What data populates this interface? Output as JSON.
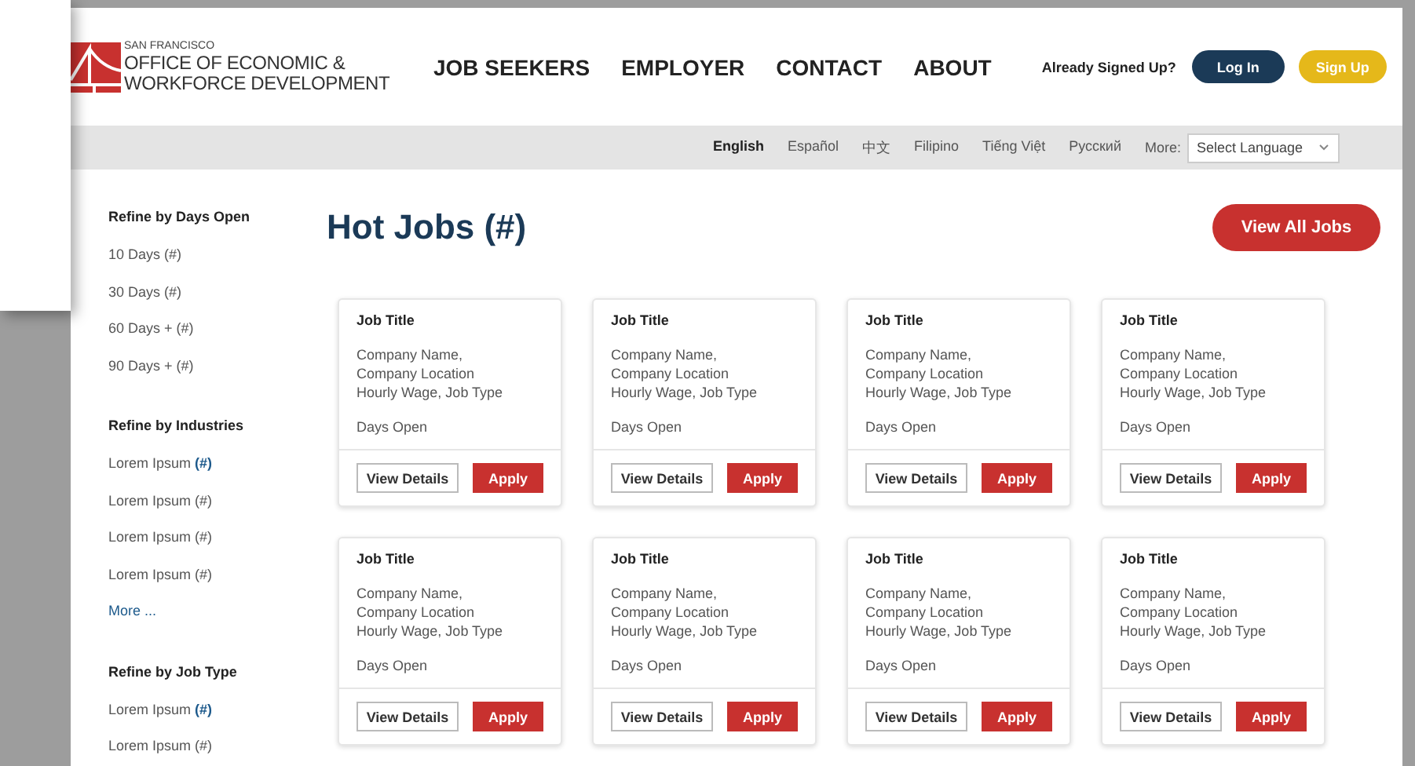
{
  "logo": {
    "city": "SAN FRANCISCO",
    "line_1": "OFFICE OF ECONOMIC &",
    "line_2": "WORKFORCE DEVELOPMENT"
  },
  "nav": [
    {
      "label": "JOB SEEKERS"
    },
    {
      "label": "EMPLOYER"
    },
    {
      "label": "CONTACT"
    },
    {
      "label": "ABOUT"
    }
  ],
  "account": {
    "prompt": "Already Signed Up?",
    "login": "Log In",
    "signup": "Sign Up"
  },
  "languages": [
    {
      "label": "English",
      "selected": true
    },
    {
      "label": "Español",
      "selected": false
    },
    {
      "label": "中文",
      "selected": false
    },
    {
      "label": "Filipino",
      "selected": false
    },
    {
      "label": "Tiếng Việt",
      "selected": false
    },
    {
      "label": "Русский",
      "selected": false
    }
  ],
  "language_more": {
    "label": "More:",
    "select": "Select Language"
  },
  "sidebar": [
    {
      "heading": "Refine by Days Open",
      "items": [
        "10 Days (#)",
        "30 Days (#)",
        "60 Days + (#)",
        "90 Days + (#)"
      ]
    },
    {
      "heading": "Refine by Industries",
      "items": [
        "Lorem Ipsum **(#)**",
        "Lorem Ipsum (#)",
        "Lorem Ipsum (#)",
        "Lorem Ipsum (#)"
      ],
      "more": "More ..."
    },
    {
      "heading": "Refine by Job Type",
      "items": [
        "Lorem Ipsum **(#)**",
        "Lorem Ipsum (#)"
      ]
    }
  ],
  "main": {
    "title": "Hot Jobs (#)",
    "view_all": "View All Jobs"
  },
  "jobs": [
    {
      "title": "Job Title",
      "company": "Company Name,",
      "location": "Company Location",
      "wage_type": "Hourly Wage, Job Type",
      "days": "Days Open",
      "details": "View Details",
      "apply": "Apply"
    },
    {
      "title": "Job Title",
      "company": "Company Name,",
      "location": "Company Location",
      "wage_type": "Hourly Wage, Job Type",
      "days": "Days Open",
      "details": "View Details",
      "apply": "Apply"
    },
    {
      "title": "Job Title",
      "company": "Company Name,",
      "location": "Company Location",
      "wage_type": "Hourly Wage, Job Type",
      "days": "Days Open",
      "details": "View Details",
      "apply": "Apply"
    },
    {
      "title": "Job Title",
      "company": "Company Name,",
      "location": "Company Location",
      "wage_type": "Hourly Wage, Job Type",
      "days": "Days Open",
      "details": "View Details",
      "apply": "Apply"
    },
    {
      "title": "Job Title",
      "company": "Company Name,",
      "location": "Company Location",
      "wage_type": "Hourly Wage, Job Type",
      "days": "Days Open",
      "details": "View Details",
      "apply": "Apply"
    },
    {
      "title": "Job Title",
      "company": "Company Name,",
      "location": "Company Location",
      "wage_type": "Hourly Wage, Job Type",
      "days": "Days Open",
      "details": "View Details",
      "apply": "Apply"
    },
    {
      "title": "Job Title",
      "company": "Company Name,",
      "location": "Company Location",
      "wage_type": "Hourly Wage, Job Type",
      "days": "Days Open",
      "details": "View Details",
      "apply": "Apply"
    },
    {
      "title": "Job Title",
      "company": "Company Name,",
      "location": "Company Location",
      "wage_type": "Hourly Wage, Job Type",
      "days": "Days Open",
      "details": "View Details",
      "apply": "Apply"
    }
  ]
}
